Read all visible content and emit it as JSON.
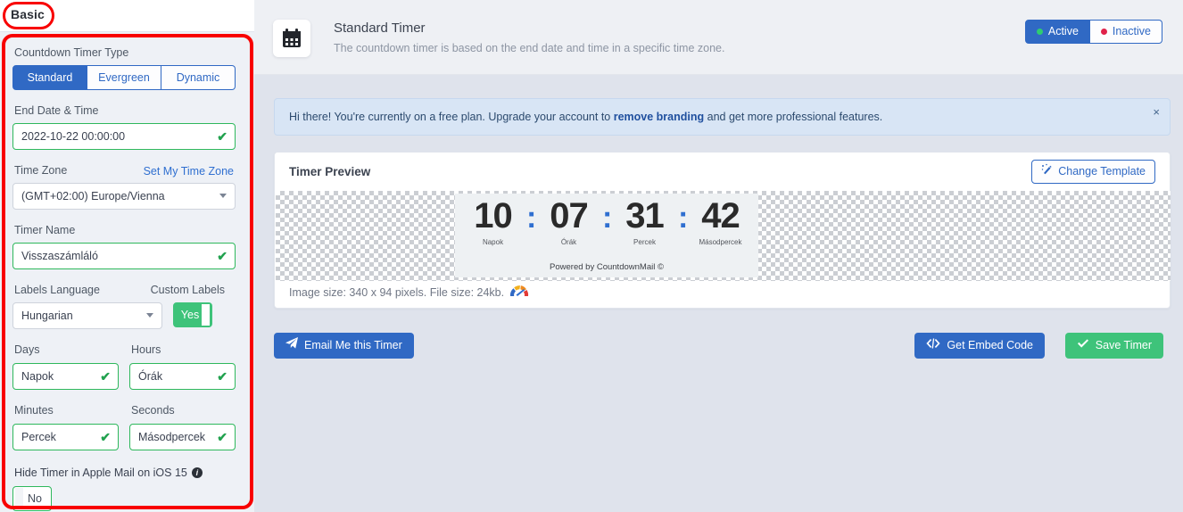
{
  "sidebar": {
    "tab_label": "Basic",
    "timer_type": {
      "label": "Countdown Timer Type",
      "options": [
        "Standard",
        "Evergreen",
        "Dynamic"
      ],
      "selected": "Standard"
    },
    "end_date": {
      "label": "End Date & Time",
      "value": "2022-10-22 00:00:00",
      "valid_icon": "✔"
    },
    "time_zone": {
      "label": "Time Zone",
      "link": "Set My Time Zone",
      "value": "(GMT+02:00) Europe/Vienna"
    },
    "timer_name": {
      "label": "Timer Name",
      "value": "Visszaszámláló",
      "valid_icon": "✔"
    },
    "labels_language": {
      "label": "Labels Language",
      "value": "Hungarian"
    },
    "custom_labels": {
      "label": "Custom Labels",
      "value": "Yes"
    },
    "label_fields": [
      {
        "label": "Days",
        "value": "Napok",
        "valid_icon": "✔"
      },
      {
        "label": "Hours",
        "value": "Órák",
        "valid_icon": "✔"
      },
      {
        "label": "Minutes",
        "value": "Percek",
        "valid_icon": "✔"
      },
      {
        "label": "Seconds",
        "value": "Másodpercek",
        "valid_icon": "✔"
      }
    ],
    "hide_timer": {
      "label": "Hide Timer in Apple Mail on iOS 15",
      "info_icon": "i",
      "value": "No"
    }
  },
  "header": {
    "icon": "calendar-icon",
    "title": "Standard Timer",
    "subtitle": "The countdown timer is based on the end date and time in a specific time zone.",
    "status": {
      "active_label": "Active",
      "inactive_label": "Inactive",
      "selected": "Active",
      "active_dot_color": "#2ecc71",
      "inactive_dot_color": "#e0224a"
    }
  },
  "alert": {
    "text_before": "Hi there! You're currently on a free plan. Upgrade your account to ",
    "link": "remove branding",
    "text_after": " and get more professional features.",
    "close_icon": "×"
  },
  "preview": {
    "title": "Timer Preview",
    "change_template_label": "Change Template",
    "change_template_icon": "magic-wand-icon",
    "countdown": {
      "days": "10",
      "hours": "07",
      "minutes": "31",
      "seconds": "42",
      "separator": ":",
      "labels": {
        "days": "Napok",
        "hours": "Órák",
        "minutes": "Percek",
        "seconds": "Másodpercek"
      },
      "footer": "Powered by CountdownMail ©"
    },
    "image_info": "Image size: 340 x 94 pixels. File size: 24kb.",
    "gauge_icon": "speed-gauge-icon"
  },
  "actions": {
    "email_label": "Email Me this Timer",
    "email_icon": "paper-plane-icon",
    "embed_label": "Get Embed Code",
    "embed_icon": "code-icon",
    "save_label": "Save Timer",
    "save_icon": "check-icon"
  },
  "colors": {
    "primary_blue": "#3069c4",
    "success_green": "#3ec37a",
    "annotation_red": "#f80000"
  }
}
